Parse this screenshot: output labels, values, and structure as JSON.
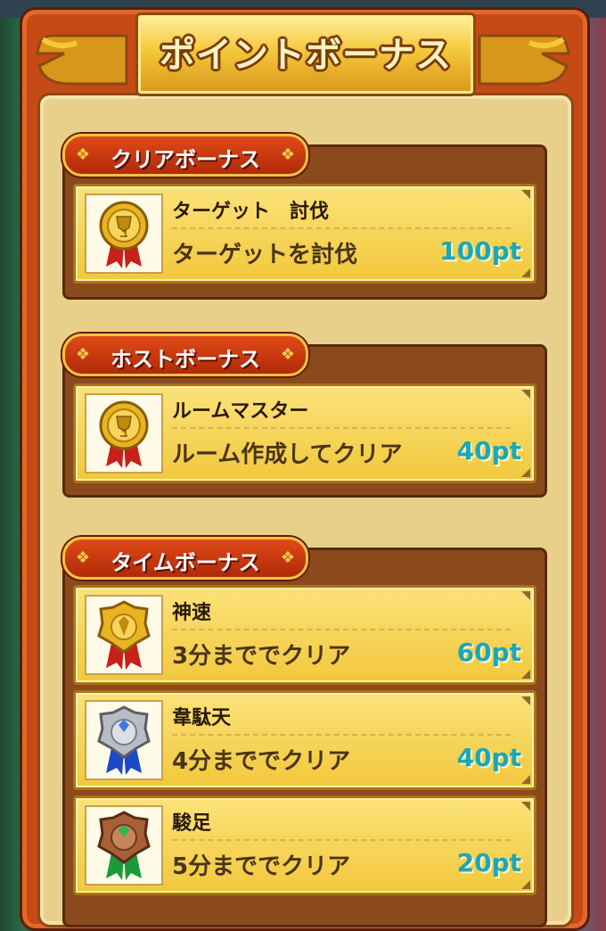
{
  "title": "ポイントボーナス",
  "sections": [
    {
      "label": "クリアボーナス",
      "items": [
        {
          "name": "ターゲット　討伐",
          "desc": "ターゲットを討伐",
          "points": "100pt",
          "medal": "gold-trophy-medal-icon"
        }
      ]
    },
    {
      "label": "ホストボーナス",
      "items": [
        {
          "name": "ルームマスター",
          "desc": "ルーム作成してクリア",
          "points": "40pt",
          "medal": "gold-trophy-medal-icon"
        }
      ]
    },
    {
      "label": "タイムボーナス",
      "items": [
        {
          "name": "神速",
          "desc": "3分まででクリア",
          "points": "60pt",
          "medal": "gold-medal-icon"
        },
        {
          "name": "韋駄天",
          "desc": "4分まででクリア",
          "points": "40pt",
          "medal": "silver-medal-icon"
        },
        {
          "name": "駿足",
          "desc": "5分まででクリア",
          "points": "20pt",
          "medal": "bronze-medal-icon"
        }
      ]
    }
  ],
  "colors": {
    "points": "#1aa8b8",
    "gold": "#e8b420",
    "silver": "#b8bcc4",
    "bronze": "#a8603a",
    "ribbon_red": "#c8201a",
    "ribbon_blue": "#1a4ac8",
    "ribbon_green": "#1a9a3a"
  }
}
